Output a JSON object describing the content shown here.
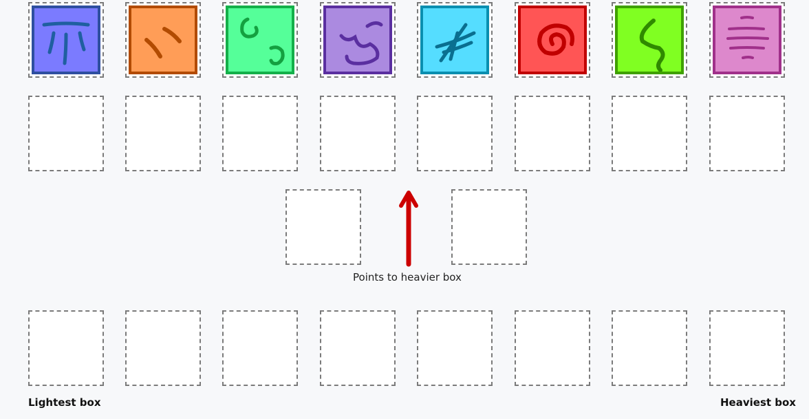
{
  "boxes": [
    {
      "id": "box-1",
      "fill": "#7b7bff",
      "border": "#2e4fa0",
      "mark": "#1f5fa0",
      "symbol": "three-lines-bar"
    },
    {
      "id": "box-2",
      "fill": "#ff9d57",
      "border": "#b24b00",
      "mark": "#b24b00",
      "symbol": "two-dashes"
    },
    {
      "id": "box-3",
      "fill": "#55ff99",
      "border": "#14b04a",
      "mark": "#14a040",
      "symbol": "two-loops"
    },
    {
      "id": "box-4",
      "fill": "#ab8ae0",
      "border": "#5a2fa0",
      "mark": "#5a2fa0",
      "symbol": "wave"
    },
    {
      "id": "box-5",
      "fill": "#55ddff",
      "border": "#0a8fb0",
      "mark": "#0a6f90",
      "symbol": "hash"
    },
    {
      "id": "box-6",
      "fill": "#ff5555",
      "border": "#c00000",
      "mark": "#c00000",
      "symbol": "spiral"
    },
    {
      "id": "box-7",
      "fill": "#80ff22",
      "border": "#3fa000",
      "mark": "#2f8a00",
      "symbol": "s-curve"
    },
    {
      "id": "box-8",
      "fill": "#dd88cc",
      "border": "#a0308a",
      "mark": "#a0308a",
      "symbol": "stacked-lines"
    }
  ],
  "comparison": {
    "caption": "Points to heavier box"
  },
  "order_row": {
    "lightest_label": "Lightest box",
    "heaviest_label": "Heaviest box"
  }
}
